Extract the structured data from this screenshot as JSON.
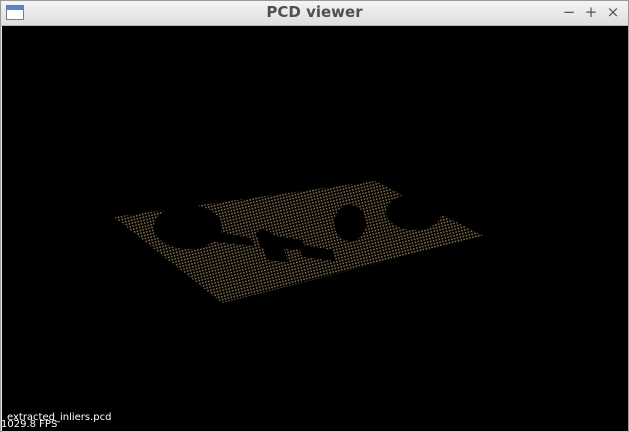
{
  "window": {
    "title": "PCD viewer",
    "controls": {
      "minimize": "−",
      "maximize": "+",
      "close": "×"
    },
    "app_icon": "window-icon"
  },
  "viewer": {
    "background_color": "#000000",
    "point_color": "#8a7350",
    "filename": "extracted_inliers.pcd",
    "fps": "1029.8 FPS"
  }
}
